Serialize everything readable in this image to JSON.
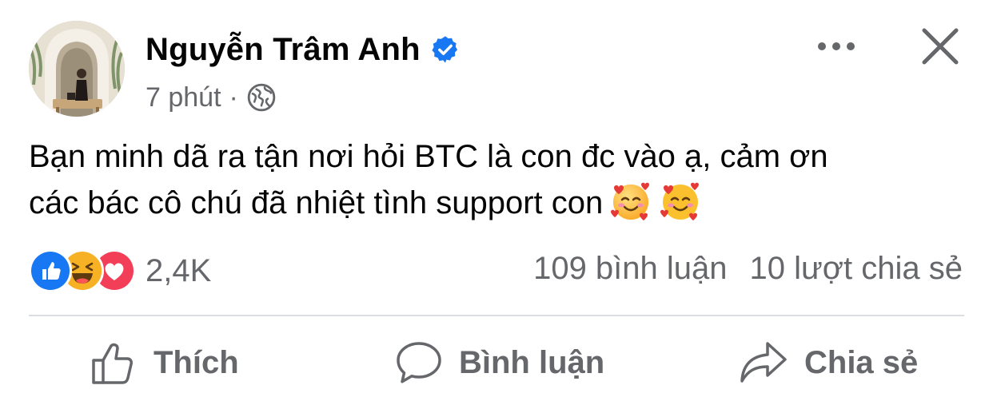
{
  "post": {
    "author": "Nguyễn Trâm Anh",
    "time": "7 phút",
    "separator": "·",
    "text_line1": "Bạn minh dã ra tận nơi hỏi BTC là con đc vào ạ, cảm ơn",
    "text_line2": "các bác cô chú đã nhiệt tình support con",
    "emojis": [
      "smiling-face-with-hearts",
      "smiling-face-with-hearts"
    ]
  },
  "reactions": {
    "types": [
      "like",
      "haha",
      "love"
    ],
    "count": "2,4K"
  },
  "stats": {
    "comments": "109 bình luận",
    "shares": "10 lượt chia sẻ"
  },
  "actions": {
    "like": "Thích",
    "comment": "Bình luận",
    "share": "Chia sẻ"
  },
  "colors": {
    "verified": "#1877f2",
    "like": "#1877f2",
    "love": "#f33e58",
    "haha": "#f7b125",
    "secondary_text": "#65676b"
  },
  "icons": {
    "verified": "verified-badge-icon",
    "audience": "globe-icon",
    "more": "more-options-icon",
    "close": "close-icon",
    "like_action": "thumbs-up-outline-icon",
    "comment_action": "comment-bubble-icon",
    "share_action": "share-arrow-icon"
  }
}
